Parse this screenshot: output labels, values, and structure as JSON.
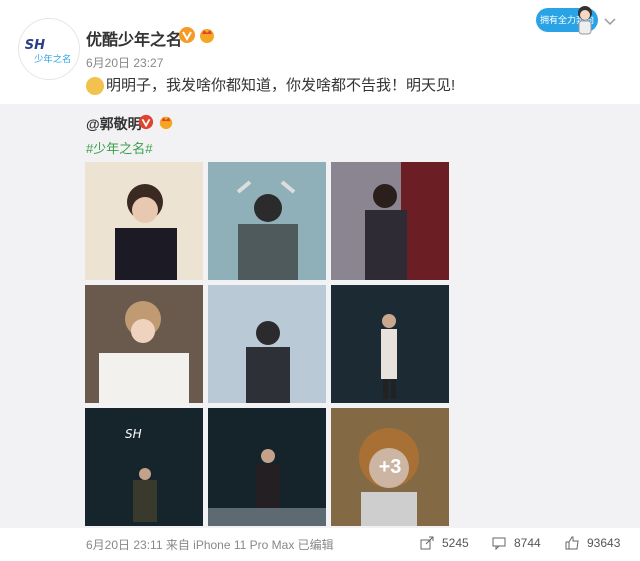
{
  "account": {
    "name": "优酷少年之名",
    "time": "6月20日 23:27",
    "logo_text": "少年之名"
  },
  "sticker": {
    "text": "拥有全力奔向你"
  },
  "post": {
    "text": "明明子，我发啥你都知道，你发啥都不告我！明天见!"
  },
  "repost": {
    "mention": "@郭敬明",
    "hashtag": "#少年之名#",
    "more_count": "+3",
    "footer": "6月20日 23:11 来自 iPhone 11 Pro Max  已编辑"
  },
  "stats": {
    "reposts": "5245",
    "comments": "8744",
    "likes": "93643"
  },
  "colors": {
    "hashtag": "#3a9e47",
    "verified": "#f59a23",
    "repost_bg": "#f2f2f5"
  }
}
